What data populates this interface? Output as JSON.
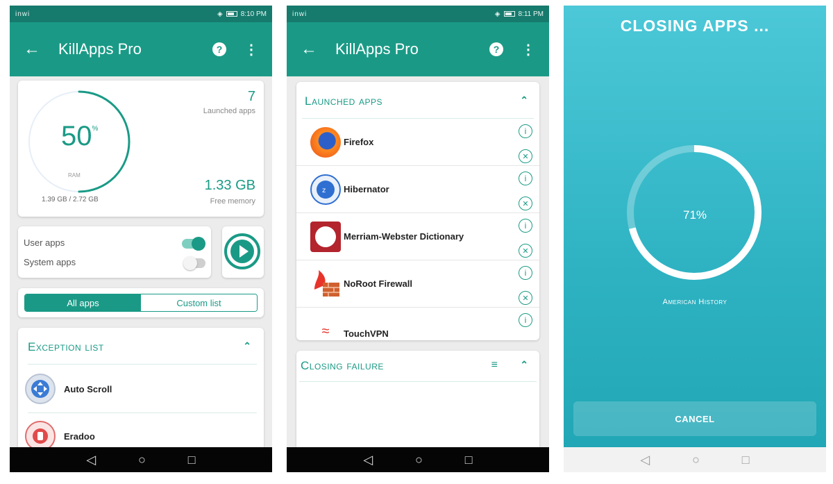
{
  "colors": {
    "primary": "#1a9a86",
    "status_bar": "#167a6d",
    "closing_bg": "#2fb3c3"
  },
  "screen1": {
    "status": {
      "carrier": "inwi",
      "time": "8:10 PM"
    },
    "appbar": {
      "title": "KillApps Pro",
      "back_icon": "back-arrow-icon",
      "help_icon": "help-icon",
      "menu_icon": "more-vert-icon"
    },
    "ram": {
      "percent": "50",
      "percent_sign": "%",
      "ring_fraction": 0.5,
      "label": "RAM",
      "used": "1.39 GB / 2.72 GB"
    },
    "launched": {
      "count": "7",
      "label": "Launched apps"
    },
    "free": {
      "value": "1.33 GB",
      "label": "Free memory"
    },
    "toggles": [
      {
        "label": "User apps",
        "on": true
      },
      {
        "label": "System apps",
        "on": false
      }
    ],
    "segment": {
      "options": [
        "All apps",
        "Custom list"
      ],
      "selected": "All apps"
    },
    "exception": {
      "header": "Exception list",
      "apps": [
        {
          "name": "Auto Scroll",
          "icon": "auto-scroll-icon"
        },
        {
          "name": "Eradoo",
          "icon": "eradoo-icon"
        }
      ]
    }
  },
  "screen2": {
    "status": {
      "carrier": "inwi",
      "time": "8:11 PM"
    },
    "appbar": {
      "title": "KillApps Pro"
    },
    "launched_section": {
      "header": "Launched apps",
      "apps": [
        {
          "name": "Firefox",
          "icon": "firefox-icon"
        },
        {
          "name": "Hibernator",
          "icon": "hibernator-icon"
        },
        {
          "name": "Merriam-Webster Dictionary",
          "icon": "merriam-webster-icon"
        },
        {
          "name": "NoRoot Firewall",
          "icon": "firewall-icon"
        },
        {
          "name": "TouchVPN",
          "icon": "vpn-icon"
        }
      ]
    },
    "failure_section": {
      "header": "Closing failure"
    }
  },
  "screen3": {
    "title": "CLOSING APPS ...",
    "progress": "71%",
    "progress_fraction": 0.71,
    "current_app": "American History",
    "cancel": "CANCEL"
  }
}
